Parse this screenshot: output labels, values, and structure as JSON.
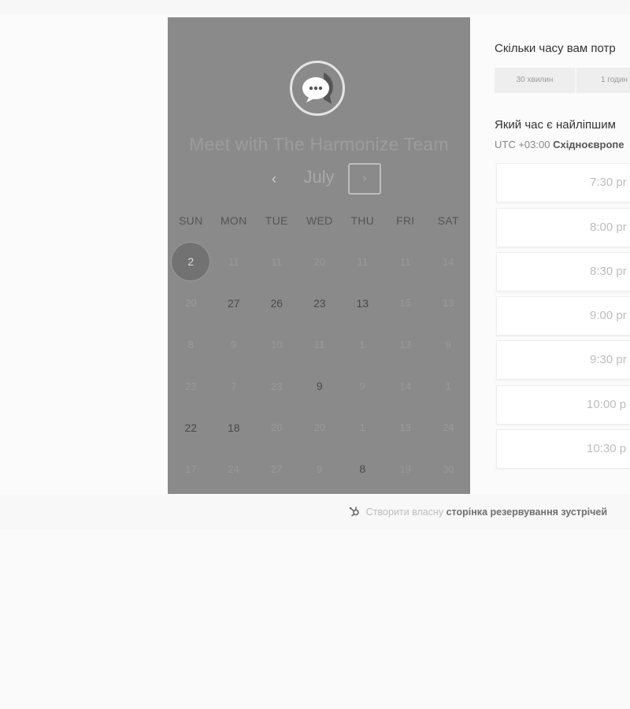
{
  "calendar": {
    "title": "Meet with The Harmonize Team",
    "month": "July",
    "prev_symbol": "‹",
    "next_symbol": "›",
    "weekdays": [
      "SUN",
      "MON",
      "TUE",
      "WED",
      "THU",
      "FRI",
      "SAT"
    ],
    "selected_day": "2",
    "weeks": [
      [
        "2",
        "11",
        "11",
        "20",
        "11",
        "11",
        "14"
      ],
      [
        "20",
        "27",
        "26",
        "23",
        "13",
        "15",
        "13"
      ],
      [
        "8",
        "9",
        "10",
        "11",
        "1",
        "13",
        "9"
      ],
      [
        "23",
        "7",
        "23",
        "9",
        "9",
        "14",
        "1"
      ],
      [
        "22",
        "18",
        "20",
        "20",
        "1",
        "13",
        "24"
      ],
      [
        "17",
        "24",
        "27",
        "9",
        "8",
        "19",
        "30"
      ]
    ],
    "available_days": [
      "27",
      "26",
      "23",
      "13",
      "9",
      "22",
      "18",
      "8"
    ]
  },
  "duration": {
    "question": "Скільки часу вам потр",
    "options": [
      "30 хвилин",
      "1 годин"
    ]
  },
  "time": {
    "question": "Який час є найліпшим",
    "timezone_offset": "UTC +03:00",
    "timezone_name": "Східноєвропе",
    "slots": [
      "7:30 pr",
      "8:00 pr",
      "8:30 pr",
      "9:00 pr",
      "9:30 pr",
      "10:00 p",
      "10:30 p"
    ]
  },
  "footer": {
    "prefix": "Створити власну",
    "link": "сторінка резервування зустрічей"
  },
  "colors": {
    "panel_bg": "#8a8a8a",
    "selected_day_bg": "#727272",
    "page_bg": "#fafafa"
  },
  "icons": {
    "logo": "chat-bubble-logo-icon",
    "footer": "hubspot-sprocket-icon"
  }
}
